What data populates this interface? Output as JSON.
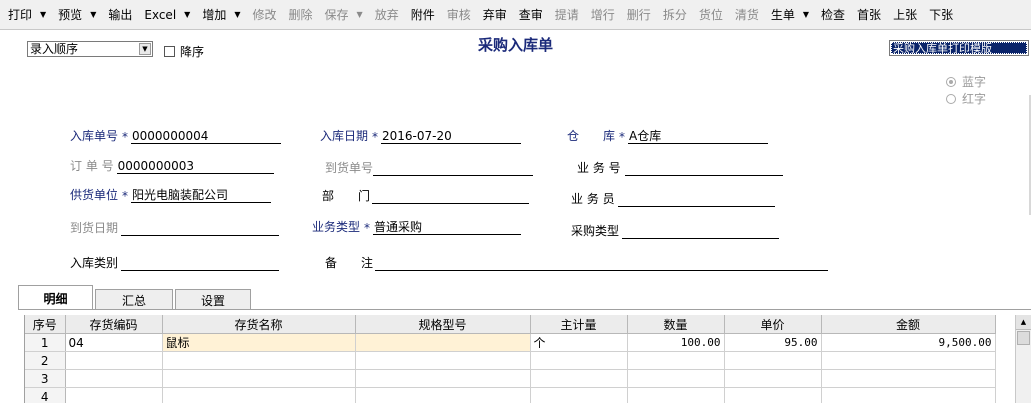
{
  "toolbar": [
    {
      "label": "打印",
      "dropdown": true,
      "enabled": true
    },
    {
      "label": "预览",
      "dropdown": true,
      "enabled": true
    },
    {
      "label": "输出",
      "dropdown": false,
      "enabled": true
    },
    {
      "label": "Excel",
      "dropdown": true,
      "enabled": true
    },
    {
      "label": "增加",
      "dropdown": true,
      "enabled": true
    },
    {
      "label": "修改",
      "dropdown": false,
      "enabled": false
    },
    {
      "label": "删除",
      "dropdown": false,
      "enabled": false
    },
    {
      "label": "保存",
      "dropdown": true,
      "enabled": false
    },
    {
      "label": "放弃",
      "dropdown": false,
      "enabled": false
    },
    {
      "label": "附件",
      "dropdown": false,
      "enabled": true
    },
    {
      "label": "审核",
      "dropdown": false,
      "enabled": false
    },
    {
      "label": "弃审",
      "dropdown": false,
      "enabled": true
    },
    {
      "label": "查审",
      "dropdown": false,
      "enabled": true
    },
    {
      "label": "提请",
      "dropdown": false,
      "enabled": false
    },
    {
      "label": "增行",
      "dropdown": false,
      "enabled": false
    },
    {
      "label": "删行",
      "dropdown": false,
      "enabled": false
    },
    {
      "label": "拆分",
      "dropdown": false,
      "enabled": false
    },
    {
      "label": "货位",
      "dropdown": false,
      "enabled": false
    },
    {
      "label": "清货",
      "dropdown": false,
      "enabled": false
    },
    {
      "label": "生单",
      "dropdown": true,
      "enabled": true
    },
    {
      "label": "检查",
      "dropdown": false,
      "enabled": true
    },
    {
      "label": "首张",
      "dropdown": false,
      "enabled": true
    },
    {
      "label": "上张",
      "dropdown": false,
      "enabled": true
    },
    {
      "label": "下张",
      "dropdown": false,
      "enabled": true
    }
  ],
  "sort": {
    "selected": "录入顺序",
    "desc_label": "降序"
  },
  "doc_title": "采购入库单",
  "print_template": "采购入库单打印模版",
  "radio": {
    "blue": "蓝字",
    "red": "红字"
  },
  "fields": {
    "receipt_no": {
      "label": "入库单号",
      "value": "0000000004"
    },
    "receipt_date": {
      "label": "入库日期",
      "value": "2016-07-20"
    },
    "warehouse": {
      "label": "仓　　库",
      "value": "A仓库"
    },
    "order_no": {
      "label": "订 单 号",
      "value": "0000000003"
    },
    "arrival_no": {
      "label": "到货单号",
      "value": ""
    },
    "business_no": {
      "label": "业 务 号",
      "value": ""
    },
    "supplier": {
      "label": "供货单位",
      "value": "阳光电脑装配公司"
    },
    "department": {
      "label": "部　　门",
      "value": ""
    },
    "salesman": {
      "label": "业 务 员",
      "value": ""
    },
    "arrival_date": {
      "label": "到货日期",
      "value": ""
    },
    "business_type": {
      "label": "业务类型",
      "value": "普通采购"
    },
    "purchase_type": {
      "label": "采购类型",
      "value": ""
    },
    "receipt_category": {
      "label": "入库类别",
      "value": ""
    },
    "remark": {
      "label": "备　　注",
      "value": ""
    }
  },
  "tabs": [
    "明细",
    "汇总",
    "设置"
  ],
  "grid": {
    "headers": [
      "序号",
      "存货编码",
      "存货名称",
      "规格型号",
      "主计量",
      "数量",
      "单价",
      "金额"
    ],
    "rows": [
      {
        "no": "1",
        "code": "04",
        "name": "鼠标",
        "spec": "",
        "unit": "个",
        "qty": "100.00",
        "price": "95.00",
        "amount": "9,500.00"
      },
      {
        "no": "2",
        "code": "",
        "name": "",
        "spec": "",
        "unit": "",
        "qty": "",
        "price": "",
        "amount": ""
      },
      {
        "no": "3",
        "code": "",
        "name": "",
        "spec": "",
        "unit": "",
        "qty": "",
        "price": "",
        "amount": ""
      },
      {
        "no": "4",
        "code": "",
        "name": "",
        "spec": "",
        "unit": "",
        "qty": "",
        "price": "",
        "amount": ""
      }
    ]
  }
}
